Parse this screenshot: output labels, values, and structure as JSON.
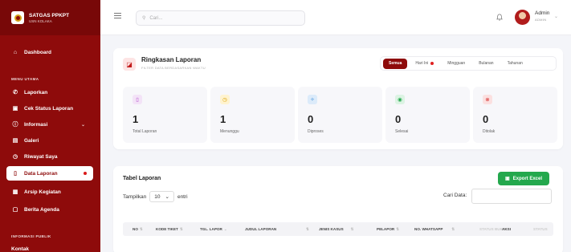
{
  "brand": {
    "name": "SATGAS PPKPT",
    "sub": "USN KOLAKA"
  },
  "sidebar": {
    "dashboard": "Dashboard",
    "section_main": "MENU UTAMA",
    "items": [
      "Laporkan",
      "Cek Status Laporan",
      "Informasi",
      "Galeri",
      "Riwayat Saya",
      "Data Laporan",
      "Arsip Kegiatan",
      "Berita Agenda"
    ],
    "section_public": "INFORMASI PUBLIK",
    "public_items": [
      "Kontak"
    ]
  },
  "topbar": {
    "search_placeholder": "Cari...",
    "user_name": "Admin",
    "user_role": "ADMIN"
  },
  "summary": {
    "title": "Ringkasan Laporan",
    "subtitle": "FILTER DATA BERDASARKAN WAKTU",
    "filters": [
      "Semua",
      "Hari Ini",
      "Mingguan",
      "Bulanan",
      "Tahunan"
    ],
    "active_filter": "Semua"
  },
  "stats": [
    {
      "value": "1",
      "label": "Total Laporan",
      "color": "#b044c9",
      "bg": "#f3e3f7",
      "icon": "document-icon"
    },
    {
      "value": "1",
      "label": "Menunggu",
      "color": "#d9a100",
      "bg": "#fff3cf",
      "icon": "clock-icon"
    },
    {
      "value": "0",
      "label": "Diproses",
      "color": "#2c83d4",
      "bg": "#dcebfa",
      "icon": "process-icon"
    },
    {
      "value": "0",
      "label": "Selesai",
      "color": "#24a84d",
      "bg": "#dcf3e3",
      "icon": "check-icon"
    },
    {
      "value": "0",
      "label": "Ditolak",
      "color": "#d42a2a",
      "bg": "#fbe0e0",
      "icon": "cancel-icon"
    }
  ],
  "table": {
    "title": "Tabel Laporan",
    "export_label": "Export Excel",
    "show_label": "Tampilkan",
    "show_value": "10",
    "entries_label": "entri",
    "search_label": "Cari Data:",
    "headers": [
      "NO",
      "KODE TIKET",
      "TGL. LAPOR",
      "JUDUL LAPORAN",
      "JENIS KASUS",
      "PELAPOR",
      "NO. WHATSAPP",
      "STATUS BUKTI",
      "AKSI",
      "STATUS"
    ]
  },
  "colors": {
    "primary": "#8e0b0b",
    "success": "#24a84d"
  }
}
